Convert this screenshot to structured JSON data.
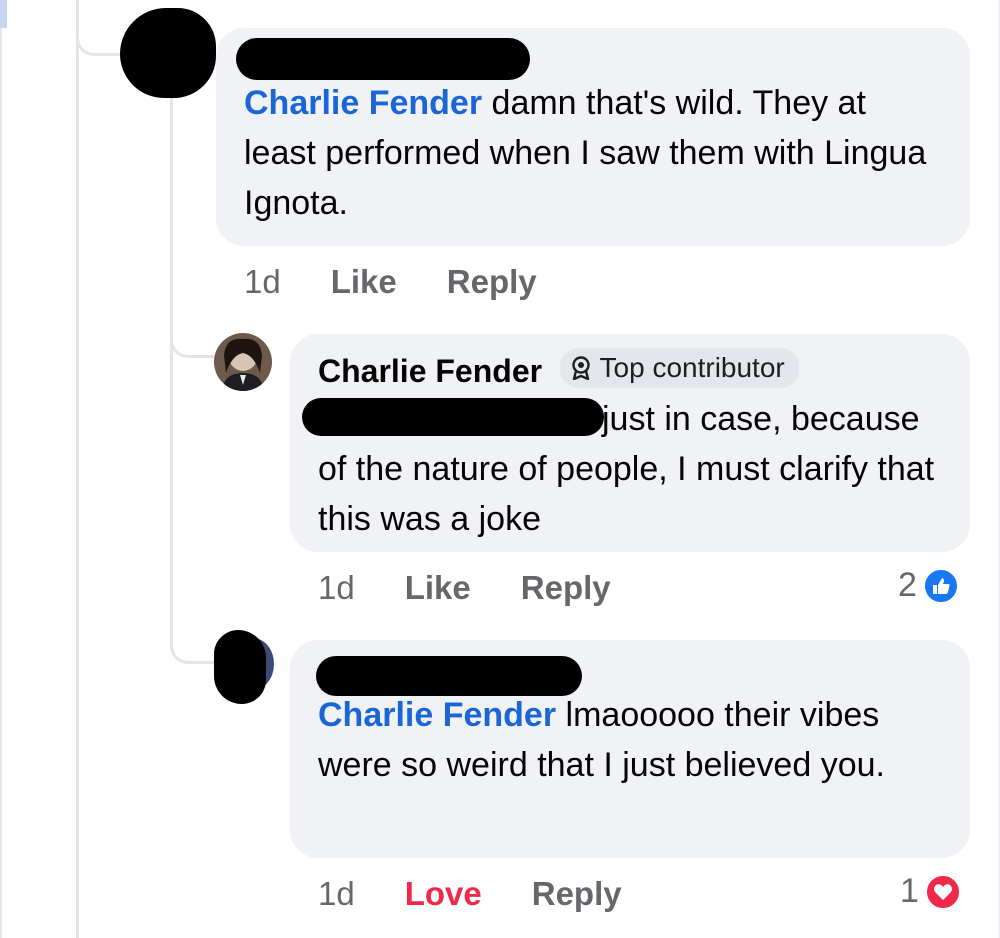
{
  "comments": [
    {
      "author": "",
      "mention": "Charlie Fender",
      "text": "damn that's wild. They at least performed when I saw them with Lingua Ignota.",
      "time": "1d",
      "actions": [
        "Like",
        "Reply"
      ],
      "reaction_count": null
    },
    {
      "author": "Charlie Fender",
      "badge": "Top contributor",
      "text": "just in case, because of the nature of people, I must clarify that this was a joke",
      "time": "1d",
      "actions": [
        "Like",
        "Reply"
      ],
      "reaction_count": "2",
      "reaction_type": "like-icon"
    },
    {
      "author": "",
      "mention": "Charlie Fender",
      "text": "lmaooooo their vibes were so weird that I just believed you.",
      "time": "1d",
      "actions": [
        "Love",
        "Reply"
      ],
      "reaction_count": "1",
      "reaction_type": "heart-icon"
    }
  ],
  "colors": {
    "mention": "#1a66d6",
    "bubble": "#f0f2f5",
    "love": "#f0284a",
    "like": "#1877f2",
    "meta": "#65676b"
  }
}
